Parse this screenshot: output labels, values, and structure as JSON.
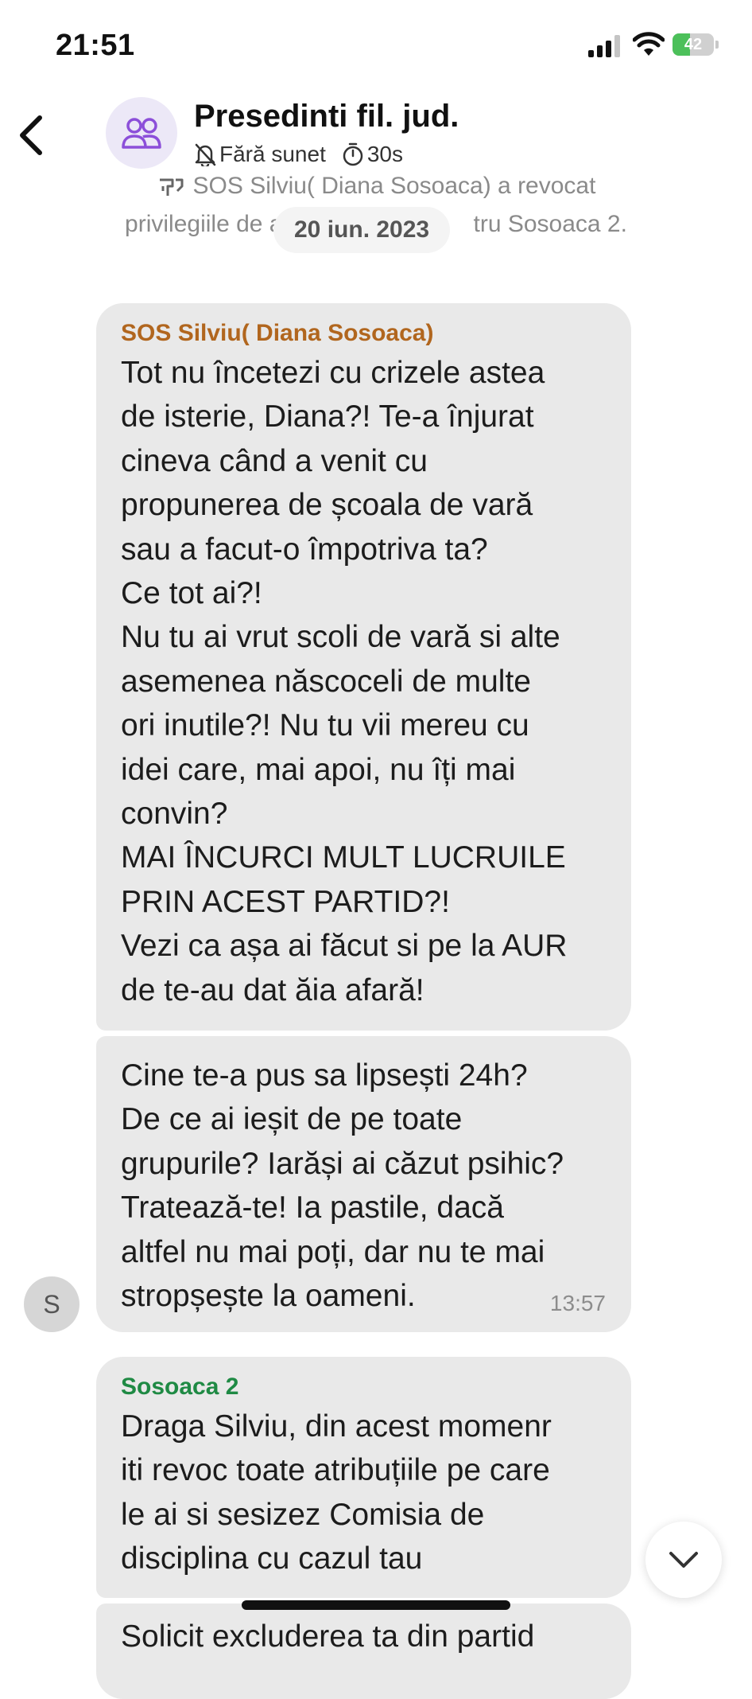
{
  "status_bar": {
    "time": "21:51",
    "battery": "42",
    "battery_level": 0.42
  },
  "header": {
    "title": "Presedinti fil. jud.",
    "mute_label": "Fără sunet",
    "timer_label": "30s"
  },
  "system_message": {
    "line1": "SOS Silviu( Diana Sosoaca) a revocat",
    "line2_start": "privilegiile de a",
    "line2_end": "tru Sosoaca 2."
  },
  "date_separator": "20 iun. 2023",
  "messages": [
    {
      "sender": "SOS Silviu( Diana Sosoaca)",
      "sender_color": "#b1661e",
      "text": "Tot nu încetezi cu crizele astea\nde isterie, Diana?! Te-a înjurat\ncineva când a venit cu\npropunerea de școala de vară\nsau a facut-o împotriva ta?\nCe tot ai?!\nNu tu ai vrut scoli de vară si alte\nasemenea născoceli de multe\nori inutile?! Nu tu vii mereu cu\nidei care, mai apoi, nu îți mai\nconvin?\nMAI ÎNCURCI MULT LUCRUILE\nPRIN ACEST PARTID?!\nVezi ca așa ai făcut si pe la AUR\nde te-au dat ăia afară!"
    },
    {
      "text": "Cine te-a pus sa lipsești 24h?\nDe ce ai ieșit de pe toate\ngrupurile? Iarăși ai căzut psihic?\nTratează-te! Ia pastile, dacă\naltfel nu mai poți, dar nu te mai\nstropșește la oameni.",
      "time": "13:57",
      "avatar_letter": "S"
    },
    {
      "sender": "Sosoaca 2",
      "sender_color": "#1f8a44",
      "text": "Draga Silviu, din acest momenr\niti revoc toate atribuțiile pe care\nle ai si sesizez Comisia de\ndisciplina cu cazul tau"
    },
    {
      "text": "Solicit excluderea ta din partid"
    }
  ],
  "colors": {
    "bubble": "#e9e9e9",
    "avatar_bg": "#ece8f7",
    "avatar_icon": "#8c4fd9"
  },
  "icons": [
    "back-chevron",
    "group-icon",
    "bell-slash-icon",
    "timer-icon",
    "pin-off-icon",
    "chevron-down-icon"
  ]
}
